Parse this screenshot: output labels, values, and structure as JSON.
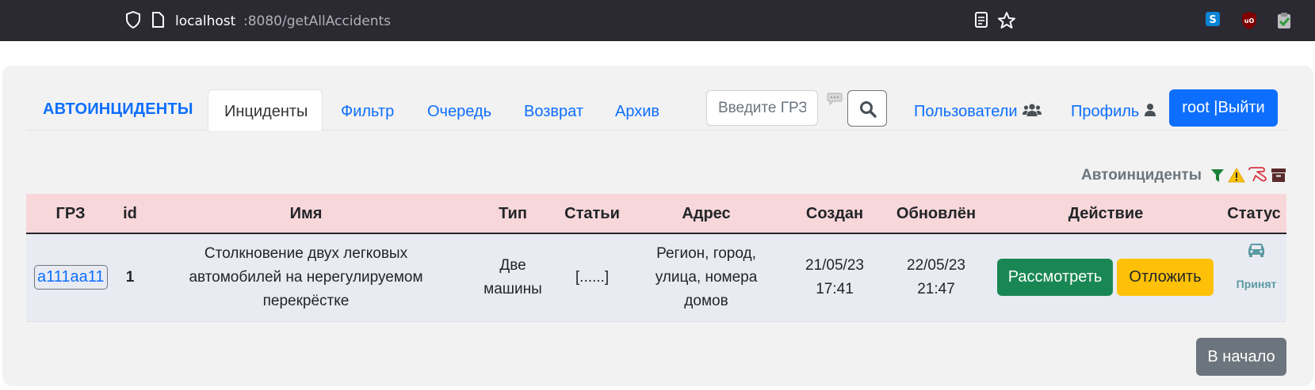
{
  "browser": {
    "url_host": "localhost",
    "url_path": ":8080/getAllAccidents"
  },
  "navbar": {
    "brand": "АВТОИНЦИДЕНТЫ",
    "links": [
      "Инциденты",
      "Фильтр",
      "Очередь",
      "Возврат",
      "Архив"
    ],
    "active_index": 0,
    "search_placeholder": "Введите ГРЗ",
    "users_label": "Пользователи",
    "profile_label": "Профиль",
    "logout_label": "root |Выйти"
  },
  "section": {
    "title": "Автоинциденты"
  },
  "table": {
    "headers": [
      "ГРЗ",
      "id",
      "Имя",
      "Тип",
      "Статьи",
      "Адрес",
      "Создан",
      "Обновлён",
      "Действие",
      "Статус"
    ],
    "rows": [
      {
        "plate": "a111aa11",
        "id": "1",
        "name_lines": [
          "Столкновение двух легковых",
          "автомобилей на нерегулируемом",
          "перекрёстке"
        ],
        "type_lines": [
          "Две",
          "машины"
        ],
        "articles": "[......]",
        "address_lines": [
          "Регион, город,",
          "улица, номера",
          "домов"
        ],
        "created_lines": [
          "21/05/23",
          "17:41"
        ],
        "updated_lines": [
          "22/05/23",
          "21:47"
        ],
        "action_review": "Рассмотреть",
        "action_postpone": "Отложить",
        "status": "Принят"
      }
    ]
  },
  "footer": {
    "back_label": "В начало"
  },
  "colors": {
    "primary": "#0d6efd",
    "success": "#198754",
    "warning": "#ffc107",
    "secondary": "#6c757d",
    "header_bg": "#f8d7da",
    "row_bg": "#e9ebf2",
    "status": "#5c9aa3"
  }
}
